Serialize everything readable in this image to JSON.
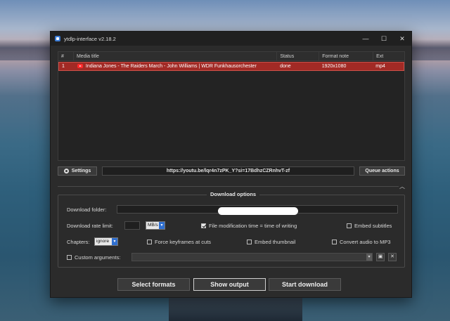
{
  "window": {
    "title": "ytdlp-interface v2.18.2",
    "controls": {
      "minimize": "—",
      "maximize": "☐",
      "close": "✕"
    }
  },
  "table": {
    "columns": [
      "#",
      "Media title",
      "Status",
      "Format note",
      "Ext"
    ],
    "rows": [
      {
        "index": "1",
        "title": "Indiana Jones - The Raiders March - John Williams | WDR Funkhausorchester",
        "status": "done",
        "format_note": "1920x1080",
        "ext": "mp4",
        "source_icon": "youtube-icon"
      }
    ]
  },
  "toolbar": {
    "settings_label": "Settings",
    "url_value": "https://youtu.be/lqr4n7zPK_Y?si=17BdhzCZRnhvT-zf",
    "queue_label": "Queue actions"
  },
  "options": {
    "title": "Download options",
    "folder_label": "Download folder:",
    "rate_label": "Download rate limit:",
    "rate_unit": "MB/s",
    "file_mod_time_label": "File modification time = time of writing",
    "file_mod_time_checked": true,
    "embed_subtitles_label": "Embed subtitles",
    "embed_subtitles_checked": false,
    "chapters_label": "Chapters:",
    "chapters_value": "ignore",
    "force_keyframes_label": "Force keyframes at cuts",
    "force_keyframes_checked": false,
    "embed_thumbnail_label": "Embed thumbnail",
    "embed_thumbnail_checked": false,
    "convert_mp3_label": "Convert audio to MP3",
    "convert_mp3_checked": false,
    "custom_args_label": "Custom arguments:",
    "custom_args_checked": false
  },
  "actions": {
    "select_formats": "Select formats",
    "show_output": "Show output",
    "start_download": "Start download"
  },
  "colors": {
    "selected_row": "#a22a25",
    "checkbox_accent": "#2f6fd0"
  }
}
